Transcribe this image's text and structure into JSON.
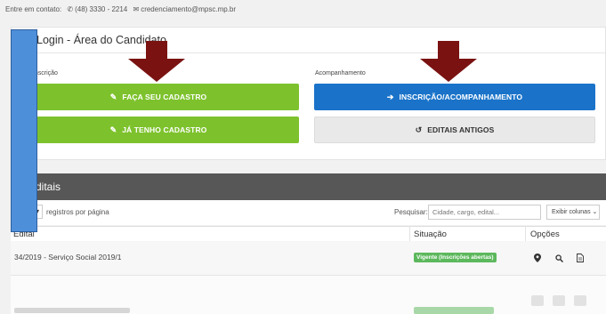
{
  "contact": {
    "prefix": "Entre em contato:",
    "phone": "(48) 3330 - 2214",
    "email": "credenciamento@mpsc.mp.br",
    "phone_icon": "phone-icon",
    "email_icon": "envelope-icon"
  },
  "panel": {
    "title": "Login - Área do Candidato",
    "title_icon": "graduation-cap-icon",
    "left_section_label": "Nova inscrição",
    "right_section_label": "Acompanhamento",
    "buttons": {
      "cadastro": "FAÇA SEU CADASTRO",
      "ja_tenho": "JÁ TENHO CADASTRO",
      "inscricao": "INSCRIÇÃO/ACOMPANHAMENTO",
      "antigos": "EDITAIS ANTIGOS"
    }
  },
  "editais": {
    "title": "Editais",
    "per_page_label": "registros por página",
    "search_label": "Pesquisar:",
    "search_placeholder": "Cidade, cargo, edital...",
    "columns_button": "Exibir colunas",
    "headers": {
      "edital": "Edital",
      "situacao": "Situação",
      "opcoes": "Opções"
    },
    "rows": [
      {
        "edital": "34/2019 - Serviço Social 2019/1",
        "situacao": "Vigente (Inscrições abertas)"
      }
    ]
  },
  "colors": {
    "green": "#7dc22c",
    "blue": "#1a73c9",
    "arrow": "#7a1212",
    "annotation_blue": "#4e8fd9",
    "header_bar": "#575757",
    "badge": "#5cb85c"
  }
}
